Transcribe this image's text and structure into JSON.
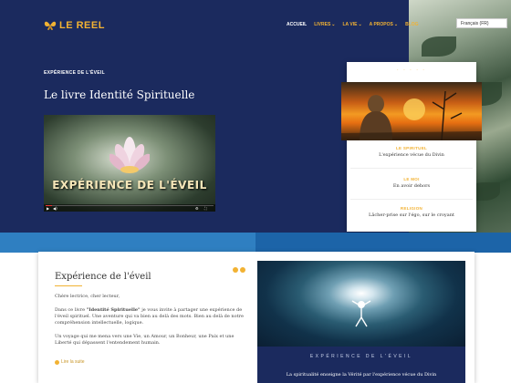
{
  "brand": {
    "name": "LE REEL"
  },
  "nav": {
    "items": [
      {
        "label": "ACCUEIL"
      },
      {
        "label": "LIVRES"
      },
      {
        "label": "LA VIE"
      },
      {
        "label": "A PROPOS"
      },
      {
        "label": "BLOG"
      }
    ],
    "language": "Français (FR)"
  },
  "hero": {
    "kicker": "EXPÉRIENCE DE L'ÉVEIL",
    "title": "Le livre Identité Spirituelle",
    "video_caption": "EXPÉRIENCE DE L'ÉVEIL"
  },
  "side_card": {
    "sections": [
      {
        "label": "LE SPIRITUEL",
        "text": "L'expérience vécue du Divin"
      },
      {
        "label": "LE MOI",
        "text": "En avoir dehors"
      },
      {
        "label": "RELIGION",
        "text": "Lâcher-prise sur l'égo, sur le croyant"
      }
    ]
  },
  "article": {
    "heading": "Expérience de l'éveil",
    "greeting": "Chère lectrice, cher lecteur,",
    "p1_prefix": "Dans ce livre ",
    "p1_book": "\"Identité Spirituelle\"",
    "p1_rest": " je vous invite à partager une expérience de l'éveil spirituel. Une aventure qui va bien au delà des mots. Bien au delà de notre compréhension intellectuelle, logique.",
    "p2": "Un voyage qui me mena vers une Vie, un Amour, un Bonheur, une Paix et une Liberté qui dépassent l'entendement humain.",
    "link": "Lire la suite"
  },
  "panel": {
    "title": "EXPÉRIENCE DE L'ÉVEIL",
    "caption": "La spiritualité enseigne la Vérité par l'expérience vécue du Divin"
  },
  "colors": {
    "navy": "#1b2a5e",
    "gold": "#f2b233",
    "blue": "#2f7fc1"
  },
  "icons": [
    "butterfly-logo-icon",
    "chevron-down-icon",
    "play-icon",
    "volume-icon",
    "settings-icon",
    "fullscreen-icon",
    "arrow-right-icon"
  ]
}
